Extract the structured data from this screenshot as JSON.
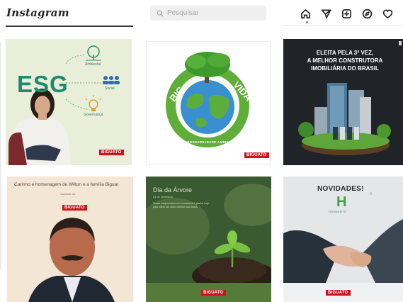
{
  "app": {
    "title": "Instagram"
  },
  "search": {
    "placeholder": "Pesquisar",
    "icon": "search-icon"
  },
  "nav": {
    "icons": [
      "home-icon",
      "direct-icon",
      "new-post-icon",
      "explore-icon",
      "activity-icon"
    ],
    "notification_color": "#ed4956"
  },
  "posts": [
    {
      "kind": "esg",
      "headline": "ESG",
      "labels": [
        "Ambiental",
        "Social",
        "Governança"
      ],
      "brand": "BIGUATO",
      "accent": "#1f8a6f"
    },
    {
      "kind": "big-vida",
      "left_word": "BIG",
      "right_word": "VIDA",
      "curve_text": "RESPONSABILIDADE AMBIENTAL",
      "brand": "BIGUATO",
      "accent": "#3b9a3b"
    },
    {
      "kind": "eleita",
      "headline_lines": [
        "ELEITA PELA 3ª VEZ,",
        "A MELHOR CONSTRUTORA",
        "IMOBILIÁRIA DO BRASIL"
      ],
      "accent": "#1f2226"
    },
    {
      "kind": "homenagem",
      "caption": "Carinho e homenagem de Wilton e a família Biguat",
      "subcaption": "Saudade de",
      "brand": "BIGUATO"
    },
    {
      "kind": "dia-arvore",
      "title": "Dia da Árvore",
      "date": "21 de setembro",
      "paragraph": "Nosso compromisso com a natureza é plantar hoje para colher um futuro melhor para todos.",
      "brand": "BIGUATO"
    },
    {
      "kind": "novidades",
      "title": "NOVIDADES!",
      "logo_letter": "H",
      "logo_sub": "HUMBERTO",
      "brand": "BIGUATO",
      "accent": "#3fa246"
    }
  ]
}
